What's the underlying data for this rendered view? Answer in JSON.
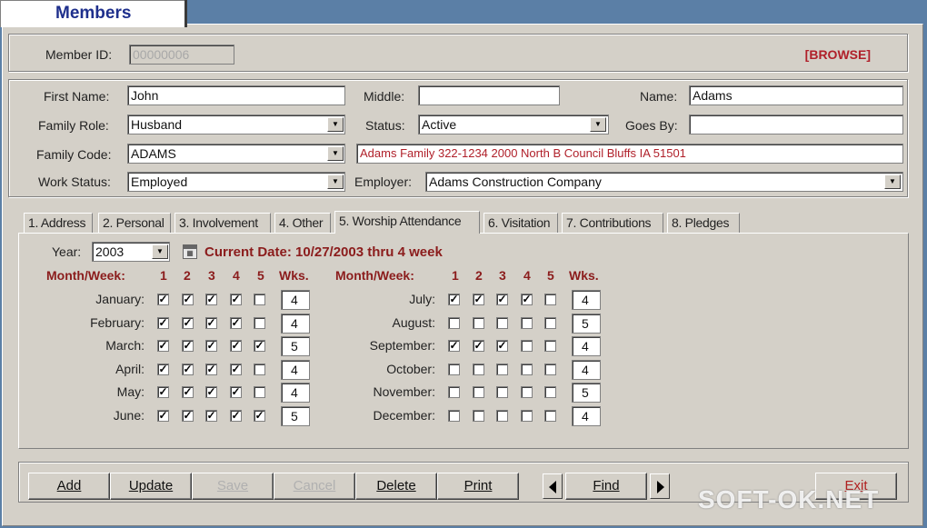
{
  "window": {
    "title": "Members"
  },
  "header": {
    "member_id_label": "Member ID:",
    "member_id_value": "00000006",
    "mode": "[BROWSE]"
  },
  "member": {
    "first_name_label": "First Name:",
    "first_name": "John",
    "middle_label": "Middle:",
    "middle": "",
    "name_label": "Name:",
    "name": "Adams",
    "family_role_label": "Family Role:",
    "family_role": "Husband",
    "status_label": "Status:",
    "status": "Active",
    "goes_by_label": "Goes By:",
    "goes_by": "",
    "family_code_label": "Family Code:",
    "family_code": "ADAMS",
    "family_address": "Adams Family 322-1234 2000 North B Council Bluffs IA 51501",
    "work_status_label": "Work Status:",
    "work_status": "Employed",
    "employer_label": "Employer:",
    "employer": "Adams Construction Company"
  },
  "tabs": [
    {
      "label": "1. Address"
    },
    {
      "label": "2. Personal"
    },
    {
      "label": "3. Involvement"
    },
    {
      "label": "4. Other"
    },
    {
      "label": "5. Worship Attendance",
      "active": true
    },
    {
      "label": "6. Visitation"
    },
    {
      "label": "7. Contributions"
    },
    {
      "label": "8. Pledges"
    }
  ],
  "attendance": {
    "year_label": "Year:",
    "year": "2003",
    "calendar_icon": "calendar-icon",
    "current_date": "Current Date: 10/27/2003 thru 4 week",
    "month_week_label": "Month/Week:",
    "week_numbers": [
      "1",
      "2",
      "3",
      "4",
      "5"
    ],
    "wks_label": "Wks.",
    "left": [
      {
        "month": "January:",
        "weeks": [
          true,
          true,
          true,
          true,
          false
        ],
        "wks": "4"
      },
      {
        "month": "February:",
        "weeks": [
          true,
          true,
          true,
          true,
          false
        ],
        "wks": "4"
      },
      {
        "month": "March:",
        "weeks": [
          true,
          true,
          true,
          true,
          true
        ],
        "wks": "5"
      },
      {
        "month": "April:",
        "weeks": [
          true,
          true,
          true,
          true,
          false
        ],
        "wks": "4"
      },
      {
        "month": "May:",
        "weeks": [
          true,
          true,
          true,
          true,
          false
        ],
        "wks": "4"
      },
      {
        "month": "June:",
        "weeks": [
          true,
          true,
          true,
          true,
          true
        ],
        "wks": "5"
      }
    ],
    "right": [
      {
        "month": "July:",
        "weeks": [
          true,
          true,
          true,
          true,
          false
        ],
        "wks": "4"
      },
      {
        "month": "August:",
        "weeks": [
          false,
          false,
          false,
          false,
          false
        ],
        "wks": "5"
      },
      {
        "month": "September:",
        "weeks": [
          true,
          true,
          true,
          false,
          false
        ],
        "wks": "4"
      },
      {
        "month": "October:",
        "weeks": [
          false,
          false,
          false,
          false,
          false
        ],
        "wks": "4"
      },
      {
        "month": "November:",
        "weeks": [
          false,
          false,
          false,
          false,
          false
        ],
        "wks": "5"
      },
      {
        "month": "December:",
        "weeks": [
          false,
          false,
          false,
          false,
          false
        ],
        "wks": "4"
      }
    ]
  },
  "buttons": {
    "add": "Add",
    "update": "Update",
    "save": "Save",
    "cancel": "Cancel",
    "delete": "Delete",
    "print": "Print",
    "find": "Find",
    "exit": "Exit"
  },
  "watermark": "SOFT-OK.NET",
  "icons": {
    "dropdown": "dropdown-arrow-icon",
    "prev": "prev-arrow-icon",
    "next": "next-arrow-icon"
  }
}
